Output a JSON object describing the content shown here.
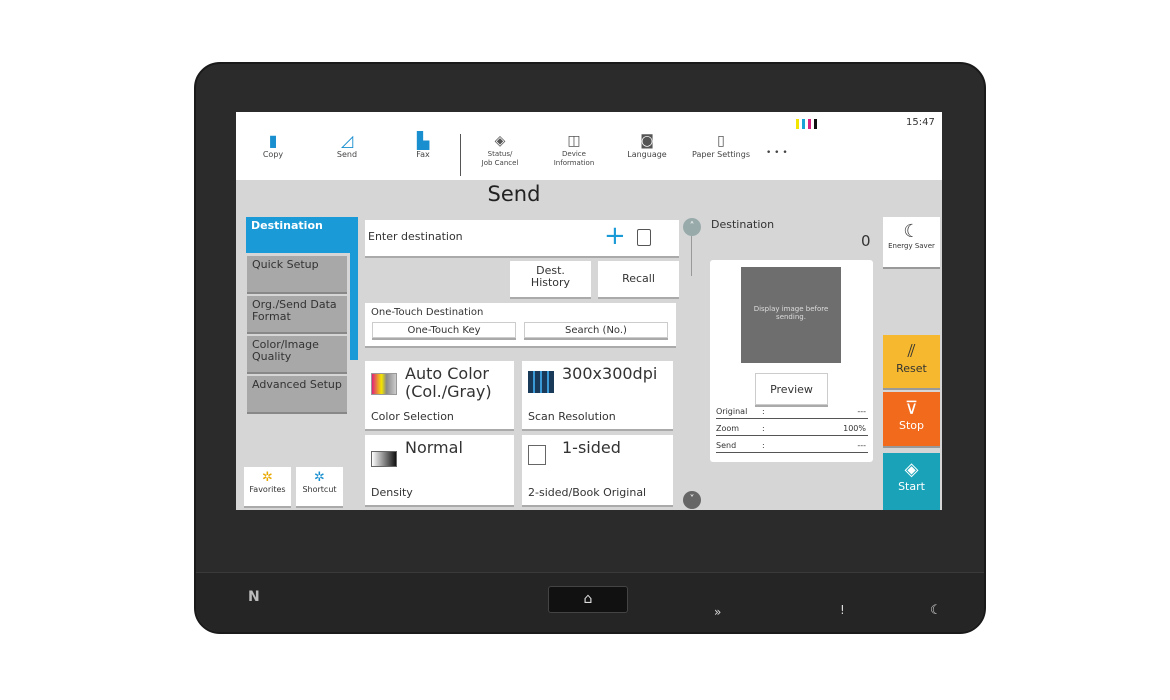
{
  "status": {
    "time": "15:47",
    "toner_colors": [
      "#f2e600",
      "#1aa3d6",
      "#d6237f",
      "#111111"
    ]
  },
  "header": {
    "items": [
      {
        "label": "Copy",
        "icon": "copy-icon"
      },
      {
        "label": "Send",
        "icon": "send-icon"
      },
      {
        "label": "Fax",
        "icon": "fax-icon"
      },
      {
        "label": "Status/\nJob Cancel",
        "icon": "status-icon"
      },
      {
        "label": "Device\nInformation",
        "icon": "device-info-icon"
      },
      {
        "label": "Language",
        "icon": "language-icon"
      },
      {
        "label": "Paper Settings",
        "icon": "paper-settings-icon"
      }
    ],
    "more": "• • •"
  },
  "page_title": "Send",
  "tabs": [
    {
      "label": "Destination"
    },
    {
      "label": "Quick Setup"
    },
    {
      "label": "Org./Send Data Format"
    },
    {
      "label": "Color/Image Quality"
    },
    {
      "label": "Advanced Setup"
    }
  ],
  "shortcuts": {
    "favorites": "Favorites",
    "shortcut": "Shortcut"
  },
  "destination": {
    "placeholder": "Enter destination",
    "add": "+",
    "dest_history": "Dest. History",
    "recall": "Recall"
  },
  "one_touch": {
    "title": "One-Touch Destination",
    "key": "One-Touch Key",
    "search": "Search (No.)"
  },
  "tiles": [
    {
      "value": "Auto Color (Col./Gray)",
      "label": "Color Selection"
    },
    {
      "value": "300x300dpi",
      "label": "Scan Resolution"
    },
    {
      "value": "Normal",
      "label": "Density"
    },
    {
      "value": "1-sided",
      "label": "2-sided/Book Original"
    }
  ],
  "right_panel": {
    "title": "Destination",
    "count": "0",
    "preview_text": "Display image before sending.",
    "preview_button": "Preview",
    "rows": [
      {
        "label": "Original",
        "sep": ":",
        "value": "---"
      },
      {
        "label": "Zoom",
        "sep": ":",
        "value": "100%"
      },
      {
        "label": "Send",
        "sep": ":",
        "value": "---"
      }
    ]
  },
  "side_buttons": {
    "energy_saver": "Energy Saver",
    "reset": "Reset",
    "stop": "Stop",
    "start": "Start"
  },
  "colors": {
    "accent": "#1a9ad6",
    "reset": "#f5b82e",
    "stop": "#f26b1d",
    "start": "#1aa3b8"
  }
}
